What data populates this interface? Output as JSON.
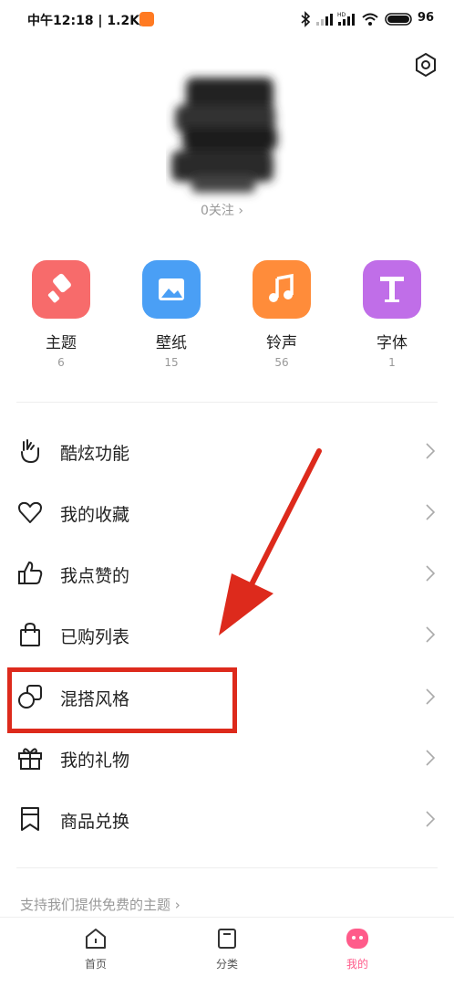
{
  "status_bar": {
    "time_speed": "中午12:18 | 1.2K/s",
    "battery": "96"
  },
  "profile": {
    "follow": "0关注 ›"
  },
  "categories": [
    {
      "label": "主题",
      "count": "6",
      "color": "#f76b6b",
      "icon": "brush-icon"
    },
    {
      "label": "壁纸",
      "count": "15",
      "color": "#4a9ff5",
      "icon": "image-icon"
    },
    {
      "label": "铃声",
      "count": "56",
      "color": "#ff8c3a",
      "icon": "music-note-icon"
    },
    {
      "label": "字体",
      "count": "1",
      "color": "#c06ee8",
      "icon": "font-icon"
    }
  ],
  "menu": [
    {
      "label": "酷炫功能",
      "icon": "hand-gesture-icon"
    },
    {
      "label": "我的收藏",
      "icon": "heart-icon"
    },
    {
      "label": "我点赞的",
      "icon": "thumbs-up-icon"
    },
    {
      "label": "已购列表",
      "icon": "shopping-bag-icon"
    },
    {
      "label": "混搭风格",
      "icon": "mix-shapes-icon"
    },
    {
      "label": "我的礼物",
      "icon": "gift-icon"
    },
    {
      "label": "商品兑换",
      "icon": "bookmark-icon"
    }
  ],
  "support_link": "支持我们提供免费的主题 ›",
  "tabs": [
    {
      "label": "首页",
      "icon": "home-icon"
    },
    {
      "label": "分类",
      "icon": "category-icon"
    },
    {
      "label": "我的",
      "icon": "profile-face-icon"
    }
  ],
  "colors": {
    "annotation_red": "#dd2a1c",
    "active_tab": "#ff5b8a"
  }
}
